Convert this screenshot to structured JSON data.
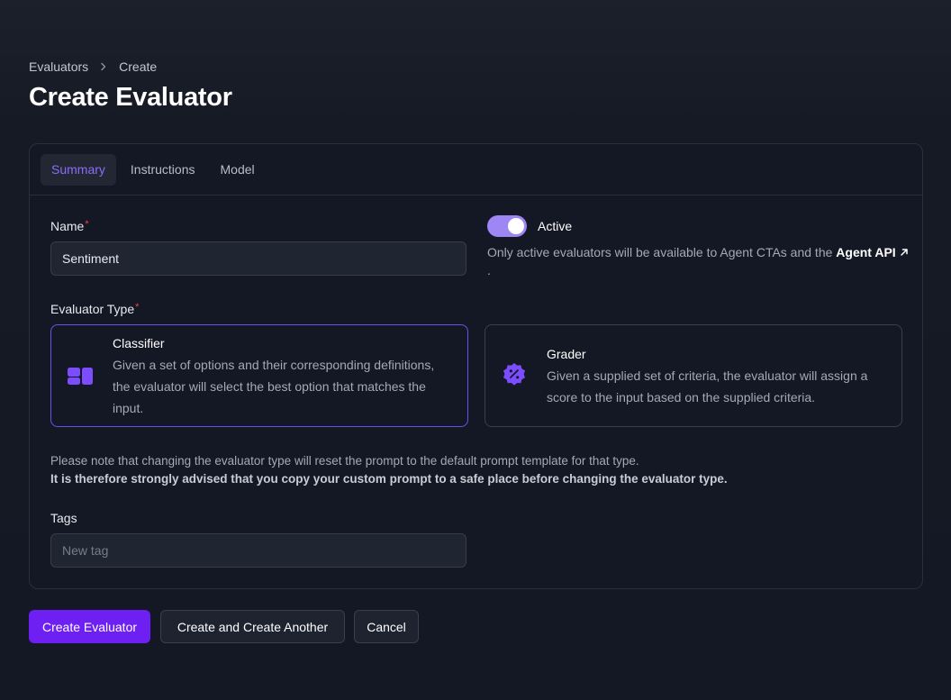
{
  "breadcrumb": {
    "items": [
      "Evaluators",
      "Create"
    ]
  },
  "page": {
    "title": "Create Evaluator"
  },
  "tabs": [
    {
      "label": "Summary",
      "active": true
    },
    {
      "label": "Instructions",
      "active": false
    },
    {
      "label": "Model",
      "active": false
    }
  ],
  "form": {
    "name": {
      "label": "Name",
      "required_mark": "*",
      "value": "Sentiment"
    },
    "active": {
      "label": "Active",
      "enabled": true,
      "help_text": "Only active evaluators will be available to Agent CTAs and the ",
      "help_link": "Agent API",
      "help_link_icon": "external-arrow-icon",
      "help_suffix": "."
    },
    "evaluator_type": {
      "label": "Evaluator Type",
      "required_mark": "*",
      "options": [
        {
          "title": "Classifier",
          "description": "Given a set of options and their corresponding definitions, the evaluator will select the best option that matches the input.",
          "icon": "classifier-blocks-icon",
          "selected": true
        },
        {
          "title": "Grader",
          "description": "Given a supplied set of criteria, the evaluator will assign a score to the input based on the supplied criteria.",
          "icon": "percent-badge-icon",
          "selected": false
        }
      ]
    },
    "note": {
      "line1": "Please note that changing the evaluator type will reset the prompt to the default prompt template for that type.",
      "line2": "It is therefore strongly advised that you copy your custom prompt to a safe place before changing the evaluator type."
    },
    "tags": {
      "label": "Tags",
      "placeholder": "New tag",
      "value": ""
    }
  },
  "actions": {
    "create": "Create Evaluator",
    "create_another": "Create and Create Another",
    "cancel": "Cancel"
  },
  "colors": {
    "accent": "#6e1ff2",
    "accent_light": "#8b6cf7",
    "toggle_on": "#9e86f4",
    "required": "#ef4444"
  }
}
